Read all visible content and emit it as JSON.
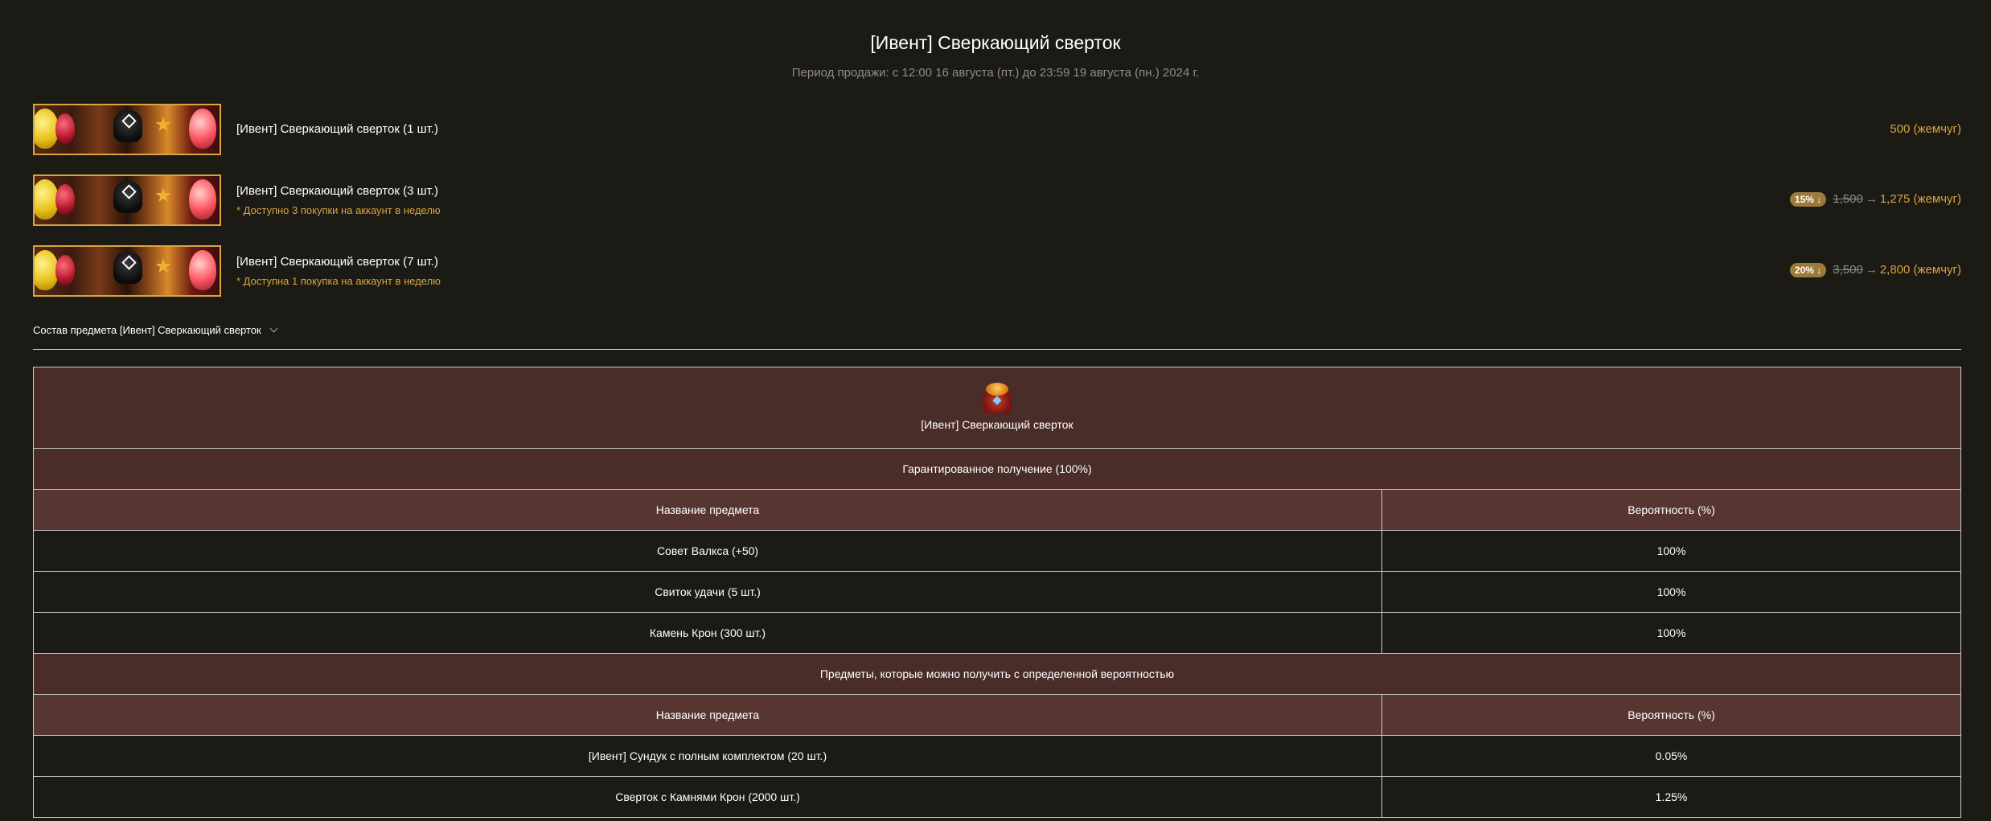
{
  "page": {
    "title": "[Ивент] Сверкающий сверток",
    "sale_period": "Период продажи: с 12:00 16 августа (пт.) до 23:59 19 августа (пн.) 2024 г."
  },
  "products": [
    {
      "name": "[Ивент] Сверкающий сверток (1 шт.)",
      "note": "",
      "price": "500 (жемчуг)"
    },
    {
      "name": "[Ивент] Сверкающий сверток (3 шт.)",
      "note": "* Доступно 3 покупки на аккаунт в неделю",
      "discount": "15% ↓",
      "old_price": "1,500",
      "arrow": "→",
      "new_price": "1,275 (жемчуг)"
    },
    {
      "name": "[Ивент] Сверкающий сверток (7 шт.)",
      "note": "* Доступна 1 покупка на аккаунт в неделю",
      "discount": "20% ↓",
      "old_price": "3,500",
      "arrow": "→",
      "new_price": "2,800 (жемчуг)"
    }
  ],
  "composition": {
    "toggle_label": "Состав предмета [Ивент] Сверкающий сверток",
    "box_name": "[Ивент] Сверкающий сверток",
    "guaranteed_header": "Гарантированное получение (100%)",
    "col_item": "Название предмета",
    "col_prob": "Вероятность (%)",
    "guaranteed_items": [
      {
        "name": "Совет Валкса (+50)",
        "prob": "100%"
      },
      {
        "name": "Свиток удачи (5 шт.)",
        "prob": "100%"
      },
      {
        "name": "Камень Крон (300 шт.)",
        "prob": "100%"
      }
    ],
    "chance_header": "Предметы, которые можно получить с определенной вероятностью",
    "chance_items": [
      {
        "name": "[Ивент] Сундук с полным комплектом (20 шт.)",
        "prob": "0.05%"
      },
      {
        "name": "Сверток с Камнями Крон (2000 шт.)",
        "prob": "1.25%"
      }
    ]
  },
  "colors": {
    "background": "#1b1a14",
    "accent_gold": "#d9a441",
    "table_header": "#4a2c28",
    "column_header": "#573632"
  }
}
